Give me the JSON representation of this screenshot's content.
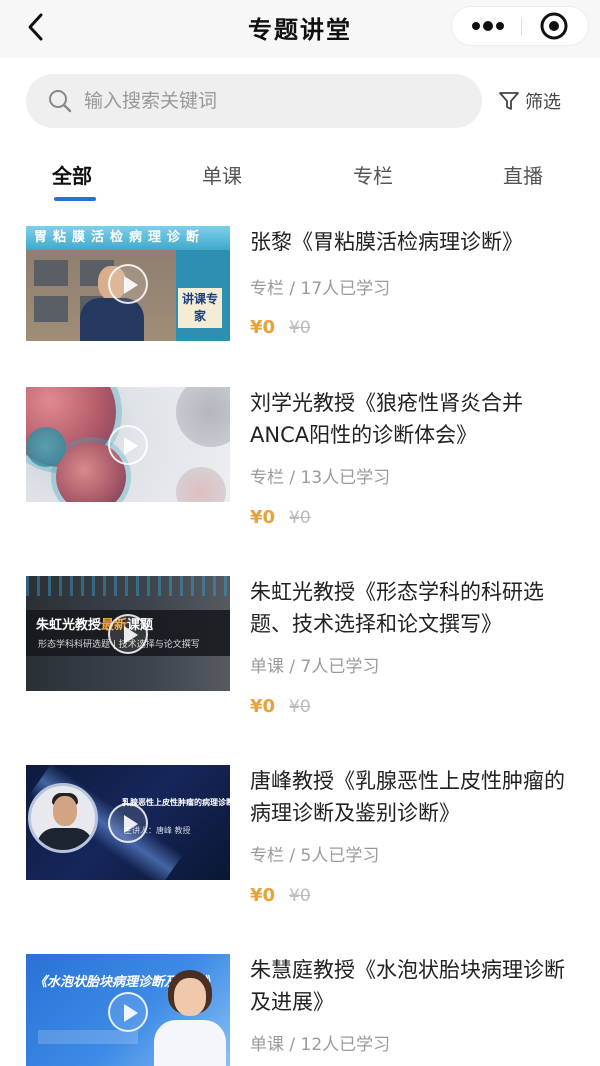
{
  "header": {
    "title": "专题讲堂"
  },
  "search": {
    "placeholder": "输入搜索关键词",
    "filter_label": "筛选"
  },
  "tabs": [
    {
      "label": "全部",
      "active": true
    },
    {
      "label": "单课",
      "active": false
    },
    {
      "label": "专栏",
      "active": false
    },
    {
      "label": "直播",
      "active": false
    }
  ],
  "colors": {
    "accent": "#2b6fd6",
    "price": "#e8a23a"
  },
  "courses": [
    {
      "title": "张黎《胃粘膜活检病理诊断》",
      "meta": "专栏 / 17人已学习",
      "price": "¥0",
      "original_price": "¥0",
      "thumb_band": "胃粘膜活检病理诊断",
      "thumb_badge": "讲课专家"
    },
    {
      "title": "刘学光教授《狼疮性肾炎合并ANCA阳性的诊断体会》",
      "meta": "专栏 / 13人已学习",
      "price": "¥0",
      "original_price": "¥0"
    },
    {
      "title": "朱虹光教授《形态学科的科研选题、技术选择和论文撰写》",
      "meta": "单课 / 7人已学习",
      "price": "¥0",
      "original_price": "¥0",
      "thumb_title_main": "朱虹光教授",
      "thumb_title_hl": "最新",
      "thumb_title_tail": "课题",
      "thumb_subtitle": "形态学科科研选题 | 技术选择与论文撰写"
    },
    {
      "title": "唐峰教授《乳腺恶性上皮性肿瘤的病理诊断及鉴别诊断》",
      "meta": "专栏 / 5人已学习",
      "price": "¥0",
      "original_price": "¥0",
      "thumb_title": "乳腺恶性上皮性肿瘤的病理诊断及鉴别诊断",
      "thumb_subtitle": "主讲人：唐峰 教授"
    },
    {
      "title": "朱慧庭教授《水泡状胎块病理诊断及进展》",
      "meta": "单课 / 12人已学习",
      "thumb_title": "《水泡状胎块病理诊断及进展》"
    }
  ]
}
